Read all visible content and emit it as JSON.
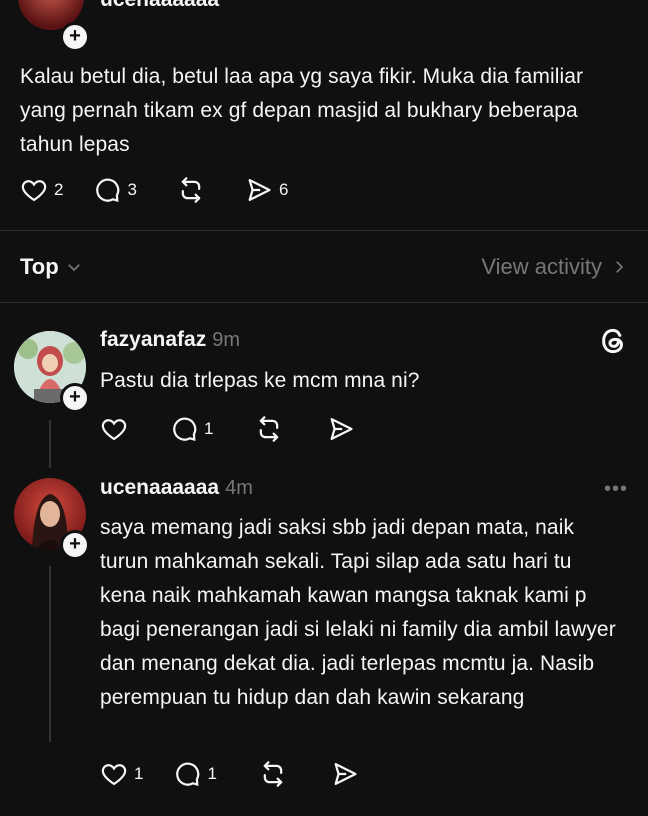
{
  "top_post": {
    "username_partial": "ucenaaaaaa",
    "text": "Kalau betul dia, betul laa apa yg saya fikir. Muka dia familiar yang pernah tikam ex gf depan masjid al bukhary beberapa tahun lepas",
    "likes": "2",
    "replies": "3"
  },
  "sort_bar": {
    "sort_label": "Top",
    "activity_label": "View activity"
  },
  "reply1": {
    "username": "fazyanafaz",
    "time": "9m",
    "text": "Pastu dia trlepas ke mcm mna ni?",
    "replies": "1"
  },
  "reply2": {
    "username": "ucenaaaaaa",
    "time": "4m",
    "text": "saya memang jadi saksi sbb jadi depan mata, naik turun mahkamah sekali. Tapi silap ada satu hari tu kena naik mahkamah kawan mangsa taknak kami p bagi penerangan jadi si lelaki ni family dia ambil lawyer dan menang dekat dia. jadi terlepas mcmtu ja. Nasib perempuan tu hidup dan dah kawin sekarang",
    "likes": "1",
    "replies": "1",
    "more_label": "•••"
  },
  "colors": {
    "background": "#101010",
    "text": "#f3f5f7",
    "muted": "#777777",
    "divider": "#2a2a2a"
  }
}
